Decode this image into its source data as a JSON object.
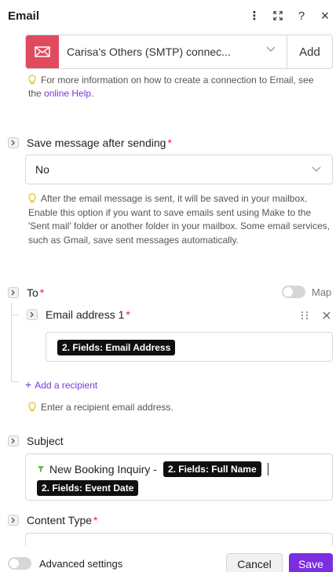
{
  "header": {
    "title": "Email",
    "more_glyph": "⋮",
    "expand_glyph": "⛶",
    "help_glyph": "?",
    "close_glyph": "×"
  },
  "connection": {
    "selected": "Carisa's Others (SMTP) connec...",
    "add_label": "Add",
    "hint_text": "For more information on how to create a connection to Email, see the",
    "hint_link": "online Help",
    "hint_end": ".",
    "icon": "envelope-icon",
    "accent_color": "#e04a5f"
  },
  "save_message": {
    "label": "Save message after sending",
    "required_mark": "*",
    "value": "No",
    "hint": "After the email message is sent, it will be saved in your mailbox. Enable this option if you want to save emails sent using Make to the 'Sent mail' folder or another folder in your mailbox. Some email services, such as Gmail, save sent messages automatically."
  },
  "to": {
    "label": "To",
    "required_mark": "*",
    "map_label": "Map",
    "email_address_1": {
      "label": "Email address 1",
      "required_mark": "*",
      "value_pill": "2. Fields: Email Address"
    },
    "add_recipient": "Add a recipient",
    "add_recipient_plus": "+",
    "hint": "Enter a recipient email address."
  },
  "subject": {
    "label": "Subject",
    "text": "New Booking Inquiry - ",
    "pill_1": "2. Fields: Full Name",
    "pill_2": "2. Fields: Event Date"
  },
  "content_type": {
    "label": "Content Type",
    "required_mark": "*"
  },
  "footer": {
    "advanced_label": "Advanced settings",
    "cancel_label": "Cancel",
    "save_label": "Save",
    "brand_color": "#7b2de0"
  }
}
